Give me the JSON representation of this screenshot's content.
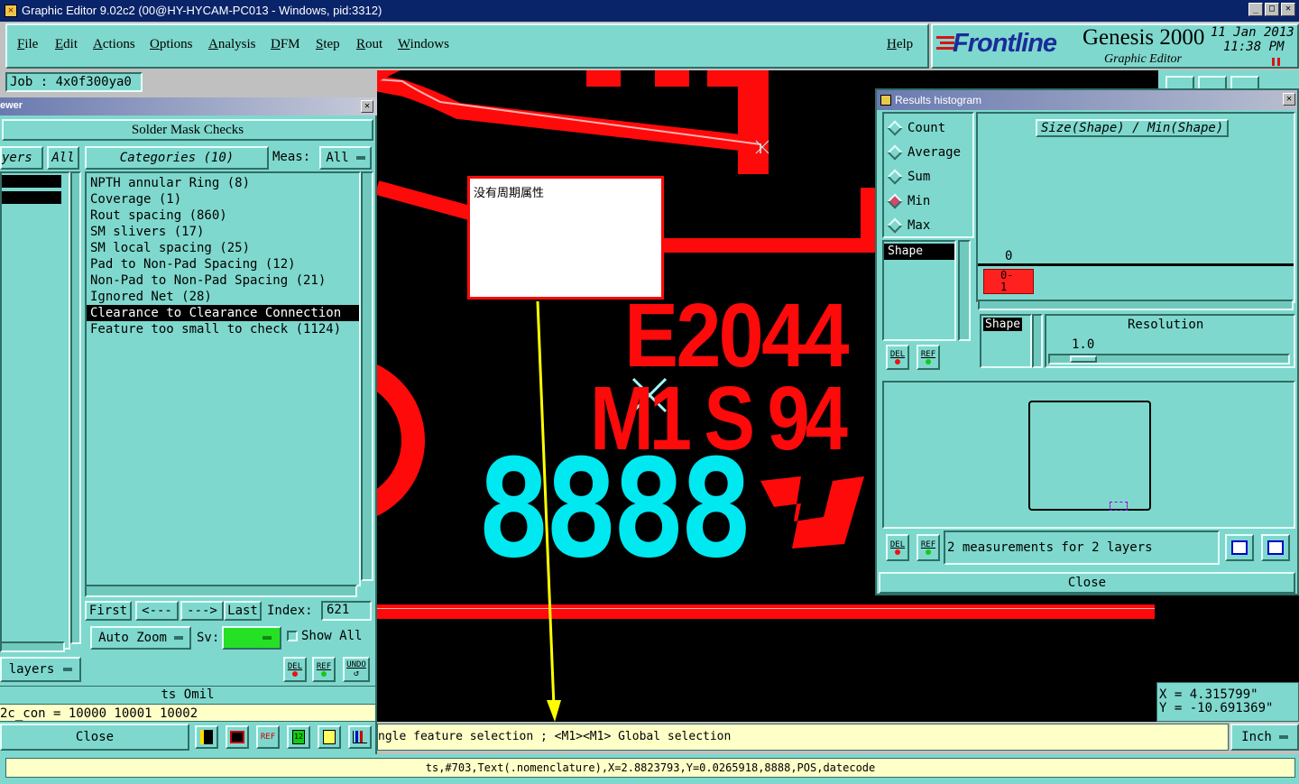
{
  "titlebar": {
    "title": "Graphic Editor 9.02c2 (00@HY-HYCAM-PC013 - Windows, pid:3312)",
    "min": "_",
    "max": "□",
    "close": "✕"
  },
  "menubar": {
    "items": [
      "File",
      "Edit",
      "Actions",
      "Options",
      "Analysis",
      "DFM",
      "Step",
      "Rout",
      "Windows"
    ],
    "help": "Help"
  },
  "brand": {
    "logo": "Frontline",
    "product": "Genesis 2000",
    "subtitle": "Graphic Editor",
    "date": "11 Jan 2013",
    "time": "11:38 PM"
  },
  "job": {
    "label": "Job : 4x0f300ya0"
  },
  "viewer": {
    "title_partial": "ewer",
    "header": "Solder Mask Checks",
    "layers_btn": "yers",
    "all_btn": "All",
    "categories_btn": "Categories (10)",
    "meas_label": "Meas:",
    "meas_value": "All",
    "categories": [
      "NPTH annular Ring (8)",
      "Coverage (1)",
      "Rout spacing (860)",
      "SM slivers (17)",
      "SM local spacing (25)",
      "Pad to Non-Pad Spacing (12)",
      "Non-Pad to Non-Pad Spacing (21)",
      "Ignored Net (28)",
      "Clearance to Clearance Connection",
      "Feature too small to check (1124)"
    ],
    "selected_index": 8,
    "nav": {
      "first": "First",
      "prev": "<---",
      "next": "--->",
      "last": "Last",
      "index_label": "Index:",
      "index_value": "621"
    },
    "auto_zoom": "Auto Zoom",
    "sv_label": "Sv:",
    "show_all": "Show All",
    "layers_dd": "layers",
    "del": "DEL",
    "ref": "REF",
    "undo": "UNDO",
    "units_text": "ts Omil",
    "code_text": "2c_con = 10000 10001 10002",
    "close": "Close"
  },
  "canvas": {
    "popup_text": "没有周期属性",
    "text_line1": "E2044",
    "text_line2": "M1 S 94",
    "digits": "8888"
  },
  "histogram": {
    "title": "Results histogram",
    "options": [
      "Count",
      "Average",
      "Sum",
      "Min",
      "Max"
    ],
    "selected_option": "Min",
    "formula": "Size(Shape) / Min(Shape)",
    "zero_label": "0",
    "bar_label": "0-\n1",
    "shape_item": "Shape",
    "shape_btn": "Shape",
    "resolution_label": "Resolution",
    "resolution_value": "1.0",
    "del": "DEL",
    "ref": "REF",
    "status": "2 measurements for 2 layers",
    "close": "Close"
  },
  "coords": {
    "x": "X = 4.315799\"",
    "y": "Y = -10.691369\""
  },
  "status": {
    "hint": "ngle feature selection ; <M1><M1> Global selection",
    "units": "Inch",
    "info": "ts,#703,Text(.nomenclature),X=2.8823793,Y=0.0265918,8888,POS,datecode"
  }
}
